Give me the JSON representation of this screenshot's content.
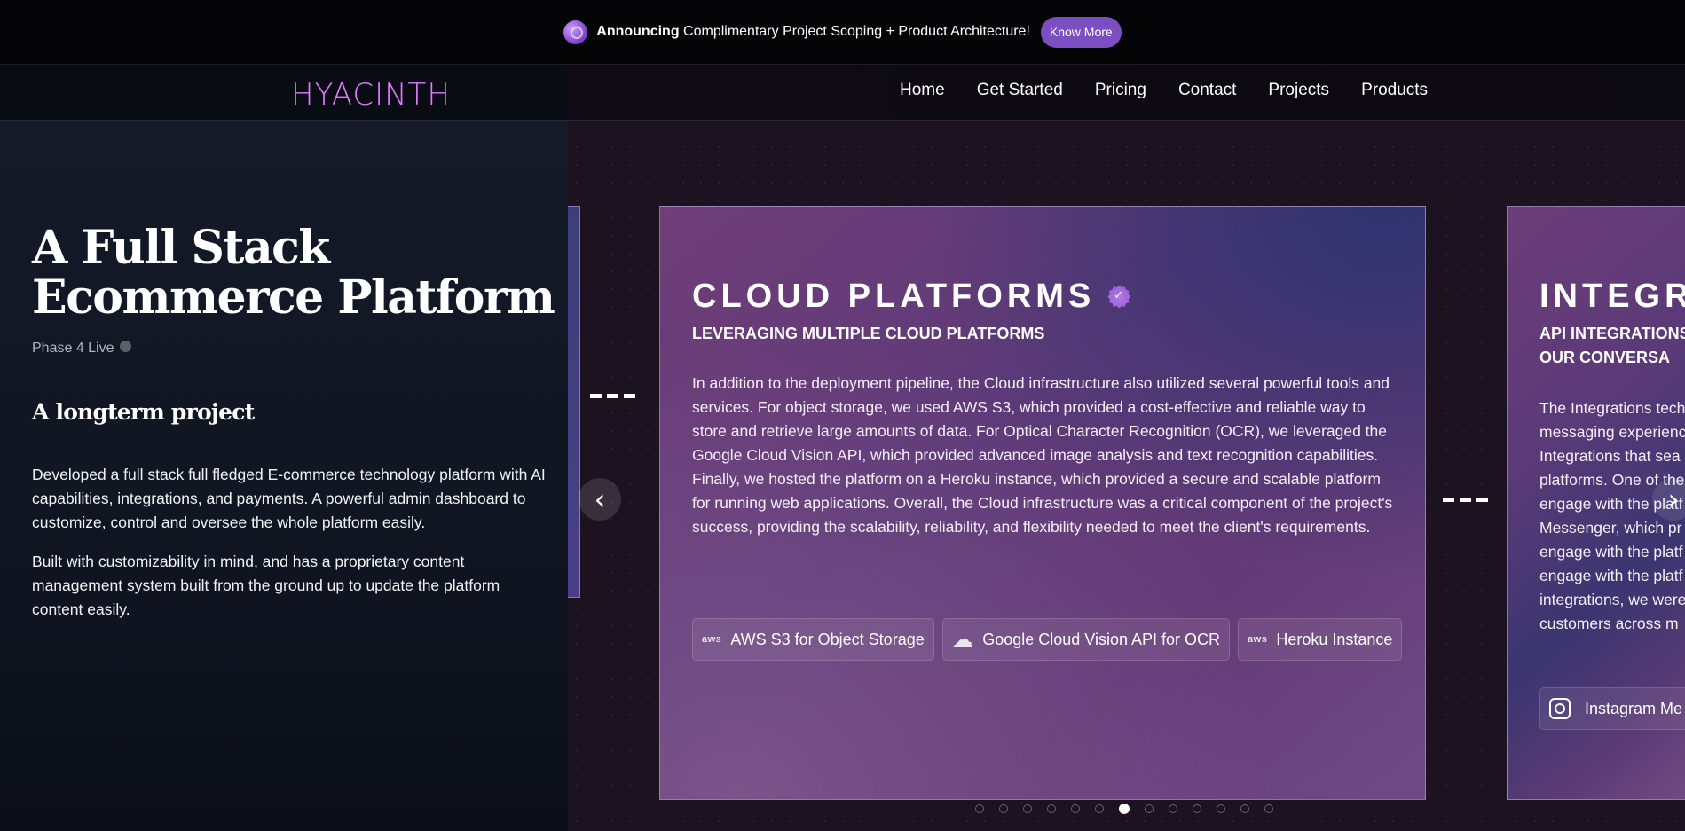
{
  "announcement": {
    "bold": "Announcing",
    "text": " Complimentary Project Scoping + Product Architecture!",
    "button": "Know More"
  },
  "nav": {
    "logo": "HYACINTH",
    "links": [
      "Home",
      "Get Started",
      "Pricing",
      "Contact",
      "Projects",
      "Products"
    ]
  },
  "project": {
    "title": "A Full Stack Ecommerce Platform",
    "phase": "Phase 4 Live",
    "subtitle": "A longterm project",
    "paragraph1": "Developed a full stack full fledged E-commerce technology platform with AI capabilities, integrations, and payments. A powerful admin dashboard to customize, control and oversee the whole platform easily.",
    "paragraph2": "Built with customizability in mind, and has a proprietary content management system built from the ground up to update the platform content easily."
  },
  "cards": {
    "main": {
      "title": "CLOUD PLATFORMS",
      "subtitle": "LEVERAGING MULTIPLE CLOUD PLATFORMS",
      "body": "In addition to the deployment pipeline, the Cloud infrastructure also utilized several powerful tools and services. For object storage, we used AWS S3, which provided a cost-effective and reliable way to store and retrieve large amounts of data. For Optical Character Recognition (OCR), we leveraged the Google Cloud Vision API, which provided advanced image analysis and text recognition capabilities. Finally, we hosted the platform on a Heroku instance, which provided a secure and scalable platform for running web applications. Overall, the Cloud infrastructure was a critical component of the project's success, providing the scalability, reliability, and flexibility needed to meet the client's requirements.",
      "tags": [
        {
          "icon": "aws",
          "label": "AWS S3 for Object Storage"
        },
        {
          "icon": "cloud-upload-icon",
          "label": "Google Cloud Vision API for OCR"
        },
        {
          "icon": "aws",
          "label": "Heroku Instance"
        }
      ]
    },
    "next": {
      "title": "INTEGRA",
      "subtitle": "API INTEGRATIONS BY OUR CONVERSA",
      "body": "The Integrations tech messaging experienc Integrations that sea platforms. One of the engage with the platf Messenger, which pr engage with the platf engage with the platf integrations, we were customers across m",
      "tag": "Instagram Me"
    }
  },
  "carousel": {
    "dot_count": 13,
    "active_index": 6,
    "prev_arrow": "‹",
    "next_arrow": "›"
  },
  "colors": {
    "accent": "#7b4fc2",
    "logo": "#e07bff"
  }
}
